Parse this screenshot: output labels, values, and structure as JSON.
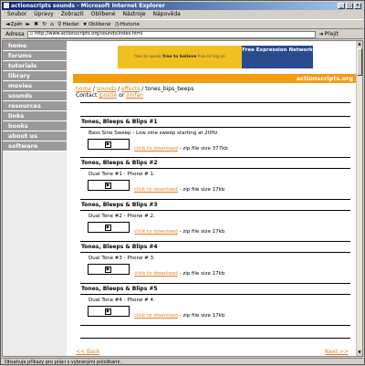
{
  "window": {
    "title": "actionscripts sounds - Microsoft Internet Explorer"
  },
  "menu": [
    "Soubor",
    "Úpravy",
    "Zobrazit",
    "Oblíbené",
    "Nástroje",
    "Nápověda"
  ],
  "toolbar": {
    "back": "Zpět",
    "search": "Hledat",
    "favorites": "Oblíbené",
    "history": "Historie"
  },
  "address": {
    "label": "Adresa",
    "url": "http://www.actionscripts.org/sounds/index.html",
    "go": "Přejít"
  },
  "sidebar": [
    "home",
    "forums",
    "tutorials",
    "library",
    "movies",
    "sounds",
    "resources",
    "links",
    "books",
    "about us",
    "software"
  ],
  "banner": {
    "left_text_a": "free to speak",
    "left_text_b": "free to believe",
    "left_text_c": "free to log on",
    "right_text": "Free Expression Network"
  },
  "site_name": "actionscripts.org",
  "breadcrumb": {
    "home": "home",
    "sep": " / ",
    "sounds": "sounds",
    "effects": "effects",
    "current": "tones_bips_beeps"
  },
  "contact": {
    "prefix": "Contact ",
    "a": "jpostie",
    "mid": " or ",
    "b": "jimfan"
  },
  "sections": [
    {
      "title": "Tones, Bleeps & Blips #1",
      "desc": "Bass Sine Sweep - Low sine sweep starting at 20Hz.",
      "dl": "click to download",
      "zip": " - zip file size 377kb"
    },
    {
      "title": "Tones, Bleeps & Blips #2",
      "desc": "Dual Tone #1 - Phone # 1.",
      "dl": "click to download",
      "zip": " - zip file size 17kb"
    },
    {
      "title": "Tones, Bleeps & Blips #3",
      "desc": "Dual Tone #2 - Phone # 2.",
      "dl": "click to download",
      "zip": " - zip file size 17kb"
    },
    {
      "title": "Tones, Bleeps & Blips #4",
      "desc": "Dual Tone #3 - Phone # 3.",
      "dl": "click to download",
      "zip": " - zip file size 17kb"
    },
    {
      "title": "Tones, Bleeps & Blips #5",
      "desc": "Dual Tone #4 - Phone # 4.",
      "dl": "click to download",
      "zip": " - zip file size 17kb"
    }
  ],
  "pager": {
    "back": "<< Back",
    "next": "Next >>"
  },
  "status": "Obsahuje příkazy pro práci s vybranými položkami.",
  "colors": {
    "accent": "#f39c12",
    "link": "#e67e22",
    "nav": "#9a9a9a",
    "titlebar": "#0a246a"
  }
}
